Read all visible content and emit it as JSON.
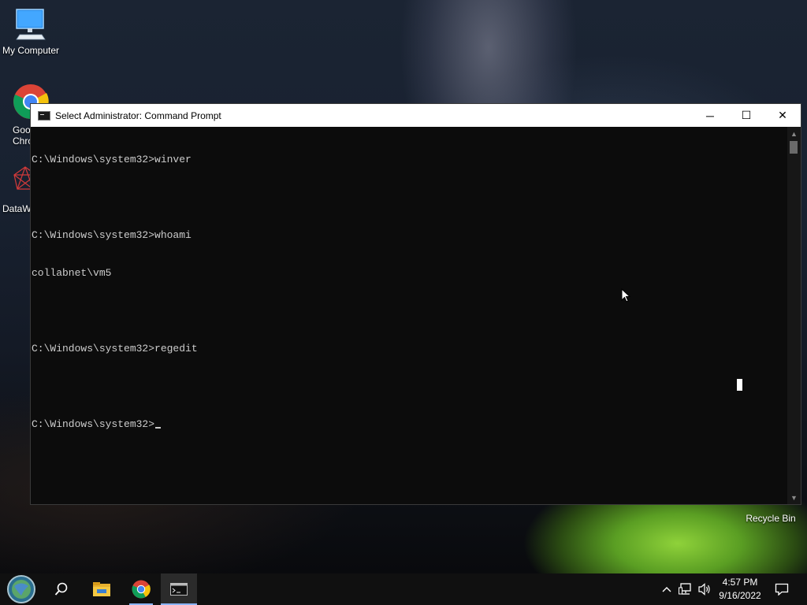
{
  "desktop": {
    "icons": [
      {
        "label": "My Computer"
      },
      {
        "label": "Goo\nChro"
      },
      {
        "label": "DataW"
      },
      {
        "label": "Recycle Bin"
      }
    ]
  },
  "window": {
    "title": "Select Administrator: Command Prompt",
    "controls": {
      "minimize": "─",
      "maximize": "☐",
      "close": "✕"
    },
    "console_lines": [
      "C:\\Windows\\system32>winver",
      "",
      "C:\\Windows\\system32>whoami",
      "collabnet\\vm5",
      "",
      "C:\\Windows\\system32>regedit",
      "",
      "C:\\Windows\\system32>"
    ]
  },
  "taskbar": {
    "clock": {
      "time": "4:57 PM",
      "date": "9/16/2022"
    },
    "accent_color": "#8ab4f8"
  }
}
